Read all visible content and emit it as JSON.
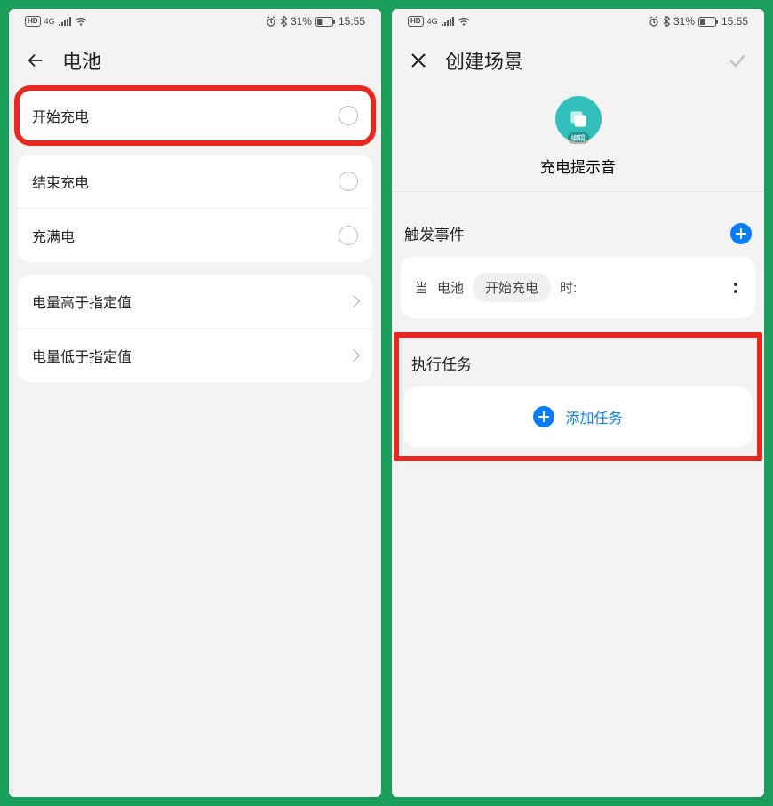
{
  "status": {
    "hd": "HD",
    "net": "4G",
    "battery": "31%",
    "time": "15:55"
  },
  "left": {
    "title": "电池",
    "options": [
      {
        "label": "开始充电",
        "type": "radio",
        "highlight": true
      },
      {
        "label": "结束充电",
        "type": "radio"
      },
      {
        "label": "充满电",
        "type": "radio"
      }
    ],
    "navrows": [
      {
        "label": "电量高于指定值"
      },
      {
        "label": "电量低于指定值"
      }
    ]
  },
  "right": {
    "title": "创建场景",
    "scene_icon_edit": "编辑",
    "scene_name": "充电提示音",
    "trigger_section": "触发事件",
    "trigger_prefix": "当",
    "trigger_subject": "电池",
    "trigger_value": "开始充电",
    "trigger_suffix": "时:",
    "task_section": "执行任务",
    "add_task": "添加任务"
  }
}
